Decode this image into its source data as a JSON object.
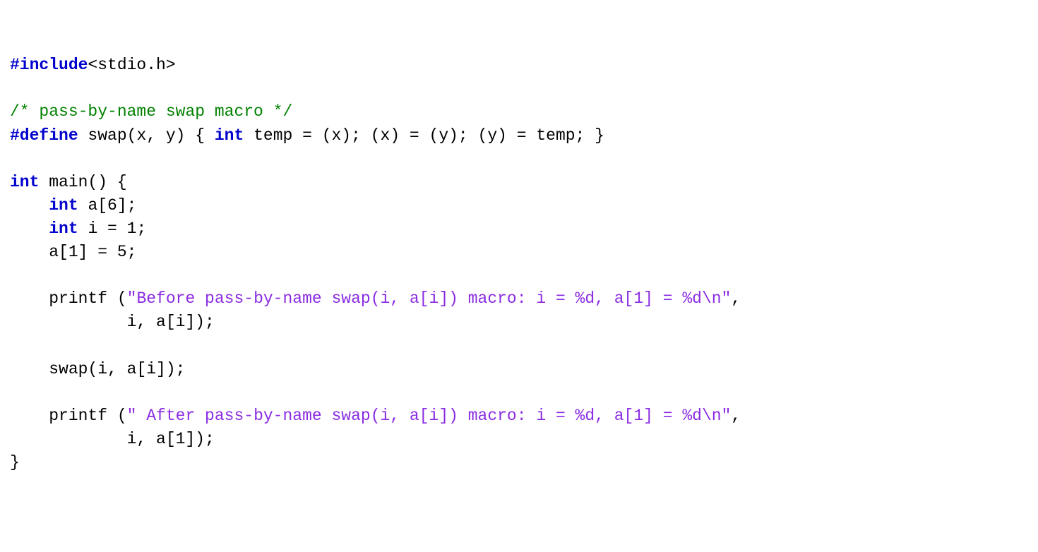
{
  "code": {
    "line01_include": "#include",
    "line01_hdr": "<stdio.h>",
    "line03_comment": "/* pass-by-name swap macro */",
    "line04_define": "#define",
    "line04_a": " swap(x, y) { ",
    "line04_int": "int",
    "line04_b": " temp = (x); (x) = (y); (y) = temp; }",
    "line06_int": "int",
    "line06_rest": " main() {",
    "line07_pad": "    ",
    "line07_int": "int",
    "line07_rest": " a[6];",
    "line08_pad": "    ",
    "line08_int": "int",
    "line08_rest": " i = 1;",
    "line09": "    a[1] = 5;",
    "line11_a": "    printf (",
    "line11_str": "\"Before pass-by-name swap(i, a[i]) macro: i = %d, a[1] = %d\\n\"",
    "line11_b": ",",
    "line12": "            i, a[i]);",
    "line14": "    swap(i, a[i]);",
    "line16_a": "    printf (",
    "line16_str": "\" After pass-by-name swap(i, a[i]) macro: i = %d, a[1] = %d\\n\"",
    "line16_b": ",",
    "line17": "            i, a[1]);",
    "line18": "}"
  }
}
